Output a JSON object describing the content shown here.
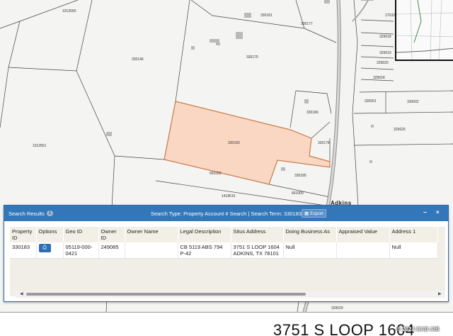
{
  "map": {
    "parcel_ids": [
      "1013550",
      "330181",
      "330177",
      "17033",
      "329618",
      "329619",
      "329620",
      "329618",
      "330146",
      "330175",
      "330001",
      "330002",
      "330180",
      "329625",
      "1013551",
      "330183",
      "330178",
      "661002",
      "330185",
      "1418615",
      "661000",
      "329629"
    ],
    "road_label": "Adkins",
    "highlight_color": "#f9d7c3",
    "highlight_border": "#c97a4a"
  },
  "panel": {
    "title": "Search Results",
    "result_count": "1",
    "search_info": "Search Type: Property Account # Search | Search Term: 330183",
    "export_label": "Export",
    "minimize_label": "–",
    "close_label": "×"
  },
  "table": {
    "headers": [
      "Property ID",
      "Options",
      "Geo ID",
      "Owner ID",
      "Owner Name",
      "Legal Description",
      "Situs Address",
      "Doing Business As",
      "Appraised Value",
      "Address 1"
    ],
    "row": {
      "property_id": "330183",
      "print_icon": "print-icon",
      "geo_id": "05119-000-0421",
      "owner_id": "249085",
      "owner_name": "",
      "legal_description": "CB 5119 ABS 794 P-42",
      "situs_address": "3751 S LOOP 1604 ADKINS, TX 78101",
      "doing_business_as": "Null",
      "appraised_value": "",
      "address_1": "Null"
    }
  },
  "footer": {
    "copyright": "© 2024 CAD AIS",
    "address_heading": "3751 S LOOP 1604"
  },
  "colors": {
    "panel_header": "#3377b8",
    "button_blue": "#2e6eb5"
  }
}
